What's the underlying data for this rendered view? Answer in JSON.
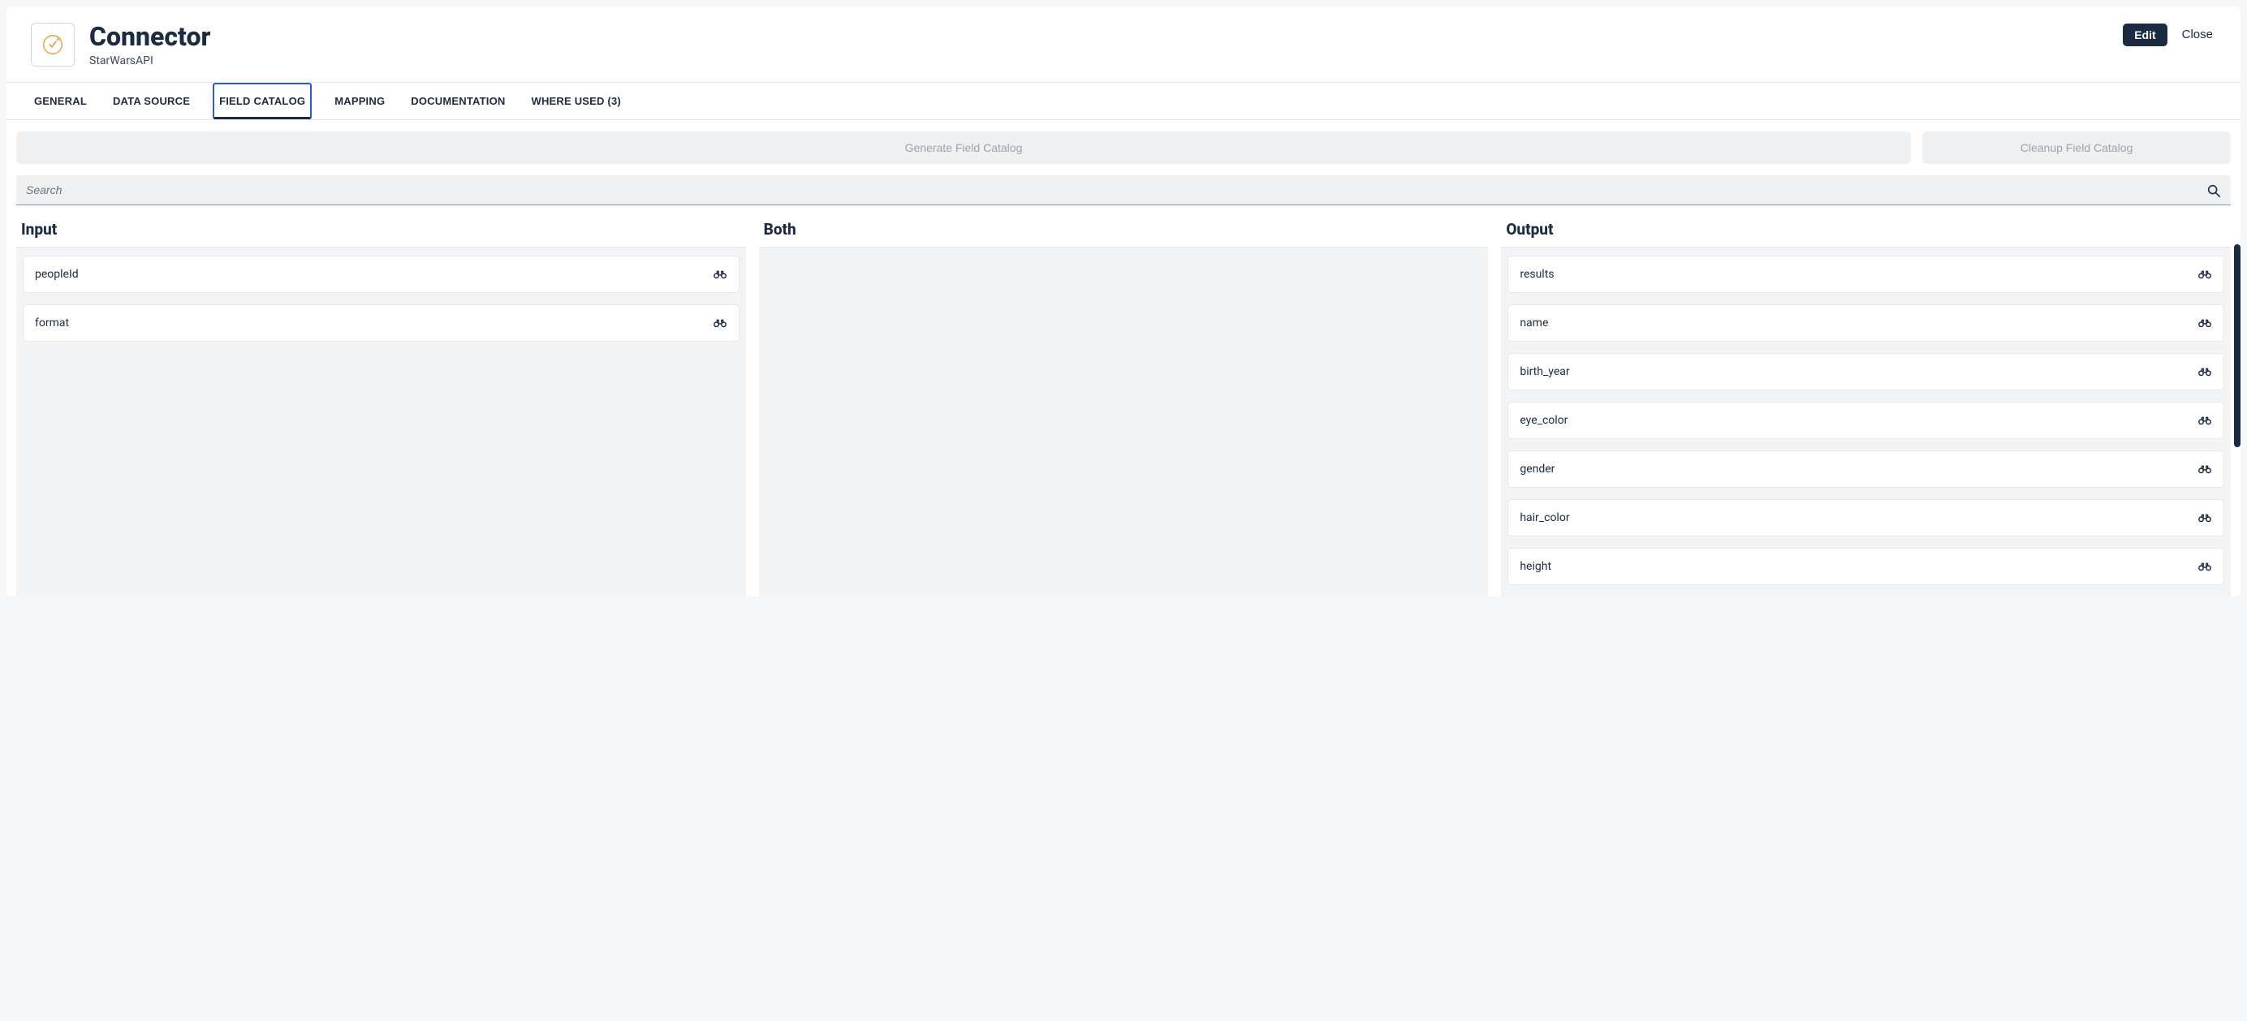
{
  "header": {
    "title": "Connector",
    "subtitle": "StarWarsAPI",
    "edit_label": "Edit",
    "close_label": "Close"
  },
  "tabs": {
    "general": "GENERAL",
    "data_source": "DATA SOURCE",
    "field_catalog": "FIELD CATALOG",
    "mapping": "MAPPING",
    "documentation": "DOCUMENTATION",
    "where_used": "WHERE USED (3)"
  },
  "actions": {
    "generate": "Generate Field Catalog",
    "cleanup": "Cleanup Field Catalog"
  },
  "search": {
    "placeholder": "Search"
  },
  "columns": {
    "input": {
      "title": "Input",
      "fields": [
        "peopleId",
        "format"
      ]
    },
    "both": {
      "title": "Both",
      "fields": []
    },
    "output": {
      "title": "Output",
      "fields": [
        "results",
        "name",
        "birth_year",
        "eye_color",
        "gender",
        "hair_color",
        "height"
      ]
    }
  }
}
